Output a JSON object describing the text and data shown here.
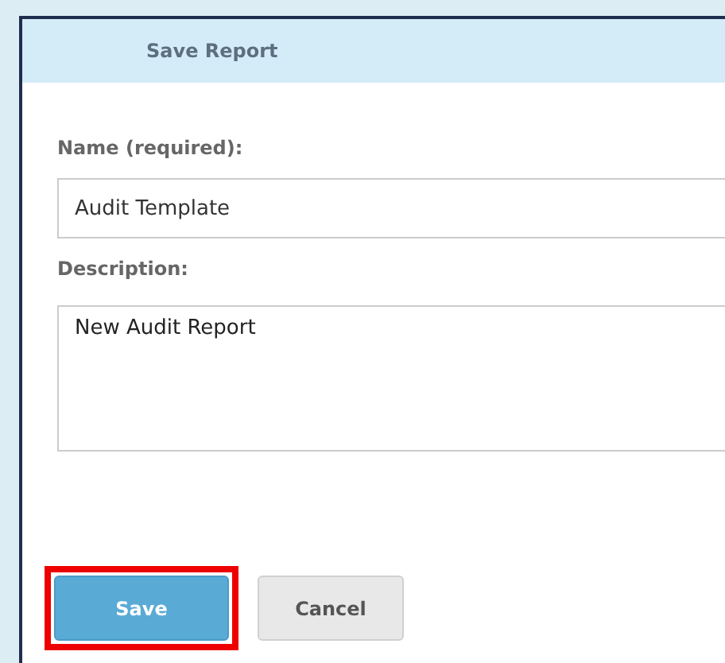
{
  "dialog": {
    "title": "Save Report"
  },
  "fields": [
    {
      "kind": "input",
      "label": "Name (required):",
      "value": "Audit Template"
    },
    {
      "kind": "textarea",
      "label": "Description:",
      "value": "New Audit Report"
    }
  ],
  "buttons": [
    {
      "label": "Save",
      "kind": "primary",
      "highlighted": true
    },
    {
      "label": "Cancel",
      "kind": "secondary",
      "highlighted": false
    }
  ]
}
